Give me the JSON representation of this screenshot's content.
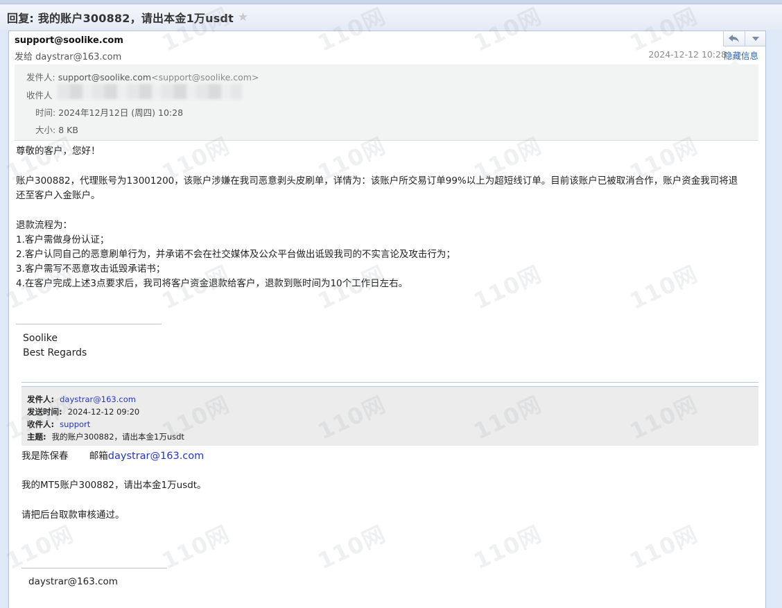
{
  "subject": {
    "title": "回复: 我的账户300882，请出本金1万usdt"
  },
  "header": {
    "from": "support@soolike.com",
    "to_label": "发给",
    "to_address": "daystrar@163.com",
    "date": "2024-12-12 10:28",
    "hide_info": "隐藏信息"
  },
  "meta": {
    "sender_label": "发件人:",
    "sender_value": "support@soolike.com",
    "sender_angle": "<support@soolike.com>",
    "recipient_label": "收件人",
    "time_label": "时间:",
    "time_value": "2024年12月12日 (周四) 10:28",
    "size_label": "大小:",
    "size_value": "8 KB"
  },
  "body": {
    "greeting": "尊敬的客户，您好！",
    "para1_line1": "账户300882，代理账号为13001200，该账户涉嫌在我司恶意剥头皮刷单，详情为：该账户所交易订单99%以上为超短线订单。目前该账户已被取消合作，账户资金我司将退",
    "para1_line2": "还至客户入金账户。",
    "process_title": "退款流程为：",
    "steps": [
      "1.客户需做身份认证；",
      "2.客户认同自己的恶意刷单行为，并承诺不会在社交媒体及公众平台做出诋毁我司的不实言论及攻击行为；",
      "3.客户需写不恶意攻击诋毁承诺书；",
      "4.在客户完成上述3点要求后，我司将客户资金退款给客户，退款到账时间为10个工作日左右。"
    ],
    "sig_name": "Soolike",
    "sig_regards": "Best Regards"
  },
  "quoted": {
    "from_label": "发件人:",
    "from_value": "daystrar@163.com",
    "sent_label": "发送时间:",
    "sent_value": "2024-12-12 09:20",
    "to_label": "收件人:",
    "to_value": "support",
    "subject_label": "主题:",
    "subject_value": "我的账户300882，请出本金1万usdt",
    "line1_name": "我是陈保春",
    "line1_mail_label": "邮箱",
    "line1_mail": "daystrar@163.com",
    "line2": "我的MT5账户300882，请出本金1万usdt。",
    "line3": "请把后台取款审核通过。",
    "signature": "daystrar@163.com"
  },
  "watermark": "110网",
  "colors": {
    "link": "#2235c9",
    "accent": "#2a64b8",
    "meta_bg": "#f2f4f3",
    "quote_bg": "#ececec"
  },
  "icons": {
    "reply": "reply-icon",
    "more": "chevron-down-icon",
    "star": "star-icon"
  }
}
